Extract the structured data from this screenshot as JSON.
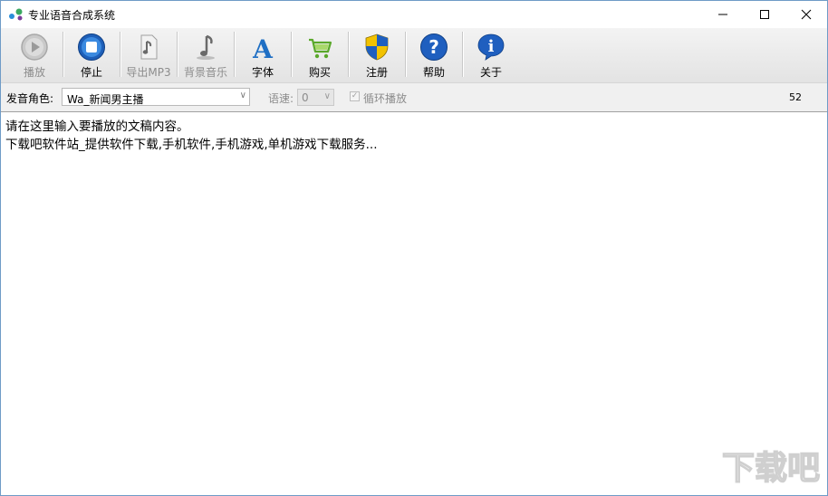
{
  "window": {
    "title": "专业语音合成系统",
    "controls": {
      "minimize": "—",
      "maximize": "☐",
      "close": "✕"
    }
  },
  "toolbar": {
    "buttons": [
      {
        "label": "播放",
        "icon": "play-icon",
        "enabled": false
      },
      {
        "label": "停止",
        "icon": "stop-icon",
        "enabled": true
      },
      {
        "label": "导出MP3",
        "icon": "music-note-icon",
        "enabled": false
      },
      {
        "label": "背景音乐",
        "icon": "music-note-icon",
        "enabled": false
      },
      {
        "label": "字体",
        "icon": "font-icon",
        "enabled": true
      },
      {
        "label": "购买",
        "icon": "cart-icon",
        "enabled": true
      },
      {
        "label": "注册",
        "icon": "shield-icon",
        "enabled": true
      },
      {
        "label": "帮助",
        "icon": "help-icon",
        "enabled": true
      },
      {
        "label": "关于",
        "icon": "info-icon",
        "enabled": true
      }
    ]
  },
  "options": {
    "voice_label": "发音角色:",
    "voice_value": "Wa_新闻男主播",
    "speed_label": "语速:",
    "speed_value": "0",
    "loop_label": "循环播放",
    "loop_checked": true,
    "counter": "52"
  },
  "editor": {
    "lines": [
      "请在这里输入要播放的文稿内容。",
      "下载吧软件站_提供软件下载,手机软件,手机游戏,单机游戏下载服务..."
    ]
  },
  "watermark": {
    "text": "下载吧"
  },
  "colors": {
    "accent_blue": "#1f6fc4",
    "disabled_text": "#8c8c8c",
    "toolbar_bg": "#ececec"
  }
}
